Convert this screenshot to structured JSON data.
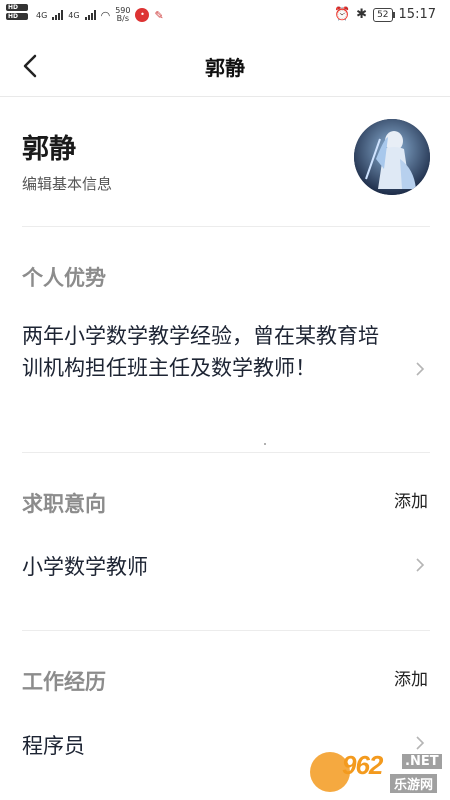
{
  "status_bar": {
    "net_speed": "590",
    "net_unit": "B/s",
    "signal_label_1": "4G",
    "signal_label_2": "4G",
    "battery": "52",
    "time": "15:17"
  },
  "header": {
    "title": "郭静"
  },
  "profile": {
    "name": "郭静",
    "edit_label": "编辑基本信息"
  },
  "advantage": {
    "title": "个人优势",
    "text": "两年小学数学教学经验，曾在某教育培训机构担任班主任及数学教师！"
  },
  "job_intention": {
    "title": "求职意向",
    "add_label": "添加",
    "value": "小学数学教师"
  },
  "work_experience": {
    "title": "工作经历",
    "add_label": "添加",
    "value": "程序员"
  },
  "watermark": {
    "number": "962",
    "net": ".NET",
    "cn": "乐游网"
  },
  "colors": {
    "section_title": "#8c8c8c",
    "body_text": "#1d2433",
    "divider": "#ececec",
    "watermark": "#f39a1e"
  }
}
